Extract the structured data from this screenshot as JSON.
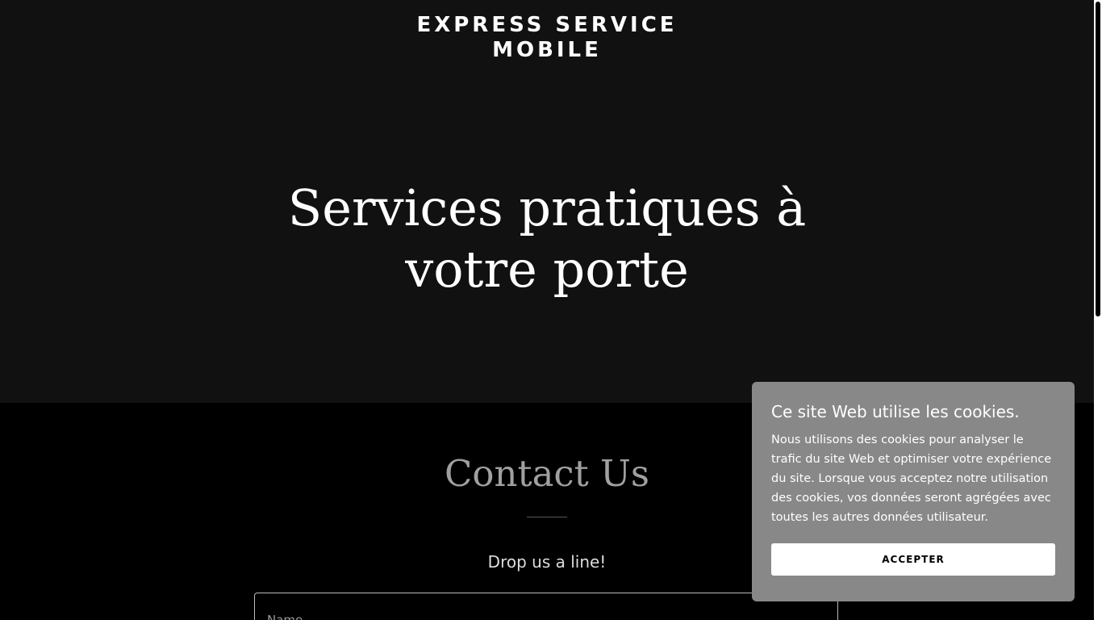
{
  "header": {
    "brand_line1": "EXPRESS SERVICE",
    "brand_line2": "MOBILE",
    "hero_title": "Services pratiques à votre porte",
    "background": "#111112"
  },
  "contact": {
    "title": "Contact Us",
    "tagline": "Drop us a line!",
    "name_placeholder": "Name"
  },
  "cookie_banner": {
    "title": "Ce site Web utilise les cookies.",
    "text": "Nous utilisons des cookies pour analyser le trafic du site Web et optimiser votre expérience du site. Lorsque vous acceptez notre utilisation des cookies, vos données seront agrégées avec toutes les autres données utilisateur.",
    "accept_label": "ACCEPTER",
    "background": "#888888"
  }
}
